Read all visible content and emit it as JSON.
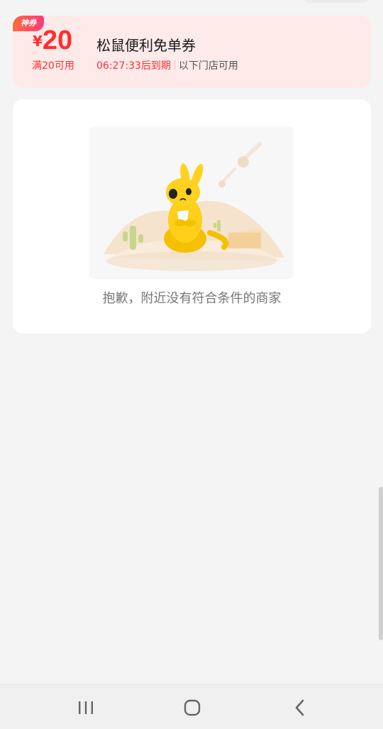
{
  "coupon": {
    "tag": "神券",
    "currency_symbol": "¥",
    "amount": "20",
    "condition": "满20可用",
    "title": "松鼠便利免单券",
    "expire_text": "06:27:33后到期",
    "store_scope": "以下门店可用"
  },
  "empty_state": {
    "message": "抱歉，附近没有符合条件的商家",
    "illustration_icon": "kangaroo-mascot-desert"
  },
  "navbar": {
    "recent_icon": "recent-apps-icon",
    "home_icon": "home-icon",
    "back_icon": "back-icon"
  },
  "colors": {
    "accent": "#ff2e2e",
    "coupon_bg": "#ffeaea",
    "page_bg": "#f4f4f4"
  }
}
